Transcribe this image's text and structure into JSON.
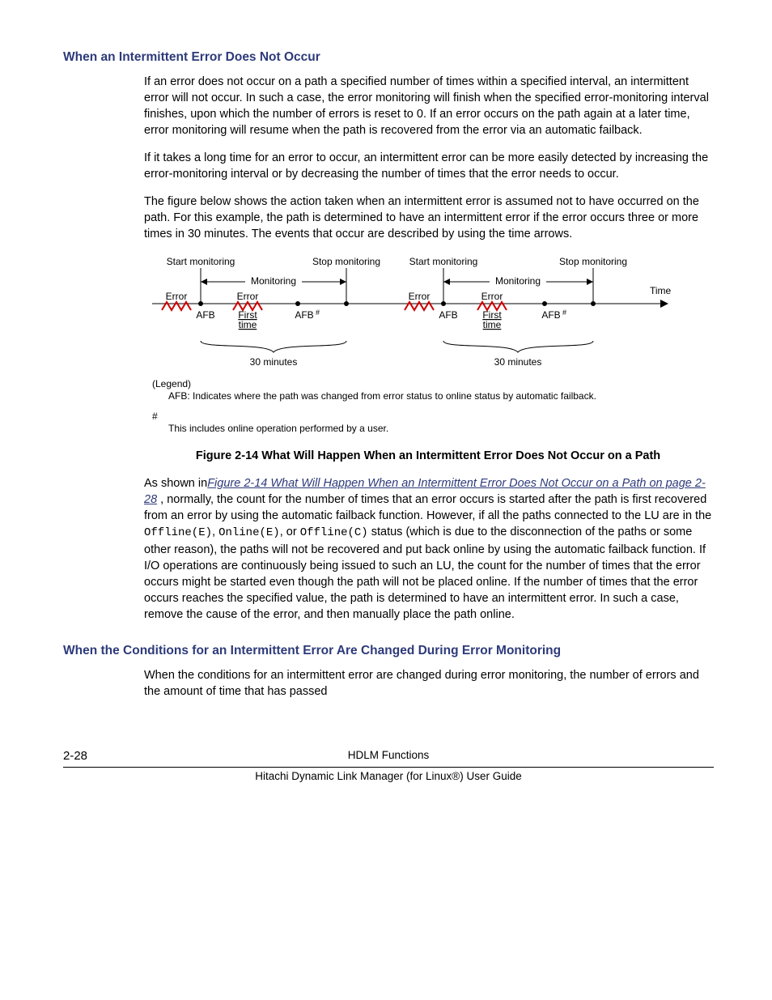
{
  "section1": {
    "heading": "When an Intermittent Error Does Not Occur",
    "p1": "If an error does not occur on a path a specified number of times within a specified interval, an intermittent error will not occur. In such a case, the error monitoring will finish when the specified error-monitoring interval finishes, upon which the number of errors is reset to 0. If an error occurs on the path again at a later time, error monitoring will resume when the path is recovered from the error via an automatic failback.",
    "p2": "If it takes a long time for an error to occur, an intermittent error can be more easily detected by increasing the error-monitoring interval or by decreasing the number of times that the error needs to occur.",
    "p3": "The figure below shows the action taken when an intermittent error is assumed not to have occurred on the path. For this example, the path is determined to have an intermittent error if the error occurs three or more times in 30 minutes. The events that occur are described by using the time arrows."
  },
  "figure": {
    "labels": {
      "start_monitoring": "Start monitoring",
      "stop_monitoring": "Stop monitoring",
      "monitoring": "Monitoring",
      "time": "Time",
      "error": "Error",
      "afb": "AFB",
      "afb_hash": "AFB",
      "first_time": "First\ntime",
      "thirty_min": "30 minutes",
      "legend_title": "(Legend)",
      "legend_afb": "AFB: Indicates where the path was changed from error status to online status by automatic failback.",
      "hash": "#",
      "hash_text": "This includes online operation performed by a user."
    },
    "caption": "Figure 2-14 What Will Happen When an Intermittent Error Does Not Occur on a Path"
  },
  "after_figure": {
    "lead": "As shown in",
    "xref": "Figure 2-14 What Will Happen When an Intermittent Error Does Not Occur on a Path on page 2-28",
    "tail1": " , normally, the count for the number of times that an error occurs is started after the path is first recovered from an error by using the automatic failback function. However, if all the paths connected to the LU are in the ",
    "code1": "Offline(E)",
    "sep1": ", ",
    "code2": "Online(E)",
    "sep2": ", or ",
    "code3": "Offline(C)",
    "tail2": " status (which is due to the disconnection of the paths or some other reason), the paths will not be recovered and put back online by using the automatic failback function. If I/O operations are continuously being issued to such an LU, the count for the number of times that the error occurs might be started even though the path will not be placed online. If the number of times that the error occurs reaches the specified value, the path is determined to have an intermittent error. In such a case, remove the cause of the error, and then manually place the path online."
  },
  "section2": {
    "heading": "When the Conditions for an Intermittent Error Are Changed During Error Monitoring",
    "p1": "When the conditions for an intermittent error are changed during error monitoring, the number of errors and the amount of time that has passed"
  },
  "footer": {
    "page": "2-28",
    "title": "HDLM Functions",
    "subtitle": "Hitachi Dynamic Link Manager (for Linux®) User Guide"
  }
}
